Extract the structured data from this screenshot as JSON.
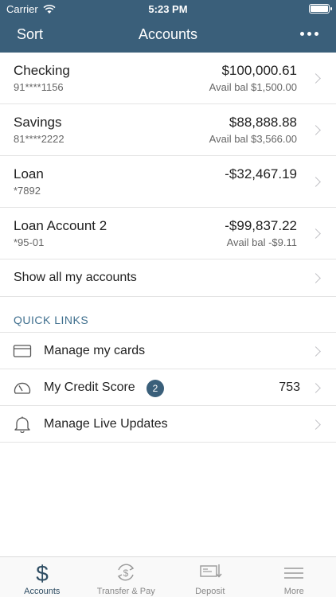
{
  "status": {
    "carrier": "Carrier",
    "time": "5:23 PM"
  },
  "nav": {
    "left_label": "Sort",
    "title": "Accounts",
    "more_icon": "more-icon"
  },
  "accounts": [
    {
      "name": "Checking",
      "number": "91****1156",
      "balance": "$100,000.61",
      "available": "Avail bal $1,500.00"
    },
    {
      "name": "Savings",
      "number": "81****2222",
      "balance": "$88,888.88",
      "available": "Avail bal $3,566.00"
    },
    {
      "name": "Loan",
      "number": "*7892",
      "balance": "-$32,467.19",
      "available": ""
    },
    {
      "name": "Loan Account 2",
      "number": "*95-01",
      "balance": "-$99,837.22",
      "available": "Avail bal -$9.11"
    }
  ],
  "show_all_label": "Show all my accounts",
  "quick_links": {
    "header": "QUICK LINKS",
    "items": [
      {
        "label": "Manage my cards",
        "icon": "credit-card-icon"
      },
      {
        "label": "My Credit Score",
        "icon": "gauge-icon",
        "badge": "2",
        "value": "753"
      },
      {
        "label": "Manage Live Updates",
        "icon": "bell-icon"
      }
    ]
  },
  "tabs": [
    {
      "label": "Accounts",
      "icon": "dollar-icon",
      "active": true
    },
    {
      "label": "Transfer & Pay",
      "icon": "transfer-icon",
      "active": false
    },
    {
      "label": "Deposit",
      "icon": "check-deposit-icon",
      "active": false
    },
    {
      "label": "More",
      "icon": "menu-icon",
      "active": false
    }
  ],
  "colors": {
    "header_bg": "#3a5f7a",
    "accent": "#3f6f8e",
    "active_tab": "#2e4d63"
  }
}
